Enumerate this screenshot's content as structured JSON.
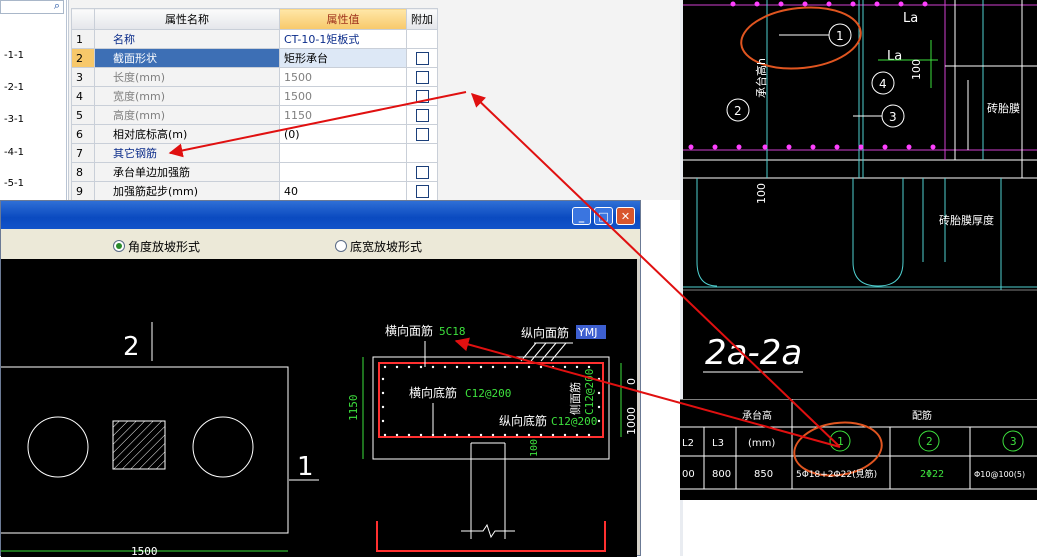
{
  "tree": {
    "items": [
      "-1-1",
      "-2-1",
      "-3-1",
      "-4-1",
      "-5-1"
    ]
  },
  "grid": {
    "headers": {
      "name": "属性名称",
      "value": "属性值",
      "extra": "附加"
    },
    "rows": [
      {
        "num": "1",
        "name": "名称",
        "value": "CT-10-1矩板式",
        "check": false,
        "style": "blue"
      },
      {
        "num": "2",
        "name": "截面形状",
        "value": "矩形承台",
        "check": true,
        "style": "sel"
      },
      {
        "num": "3",
        "name": "长度(mm)",
        "value": "1500",
        "check": true,
        "style": "gray"
      },
      {
        "num": "4",
        "name": "宽度(mm)",
        "value": "1500",
        "check": true,
        "style": "gray"
      },
      {
        "num": "5",
        "name": "高度(mm)",
        "value": "1150",
        "check": true,
        "style": "gray"
      },
      {
        "num": "6",
        "name": "相对底标高(m)",
        "value": "(0)",
        "check": true,
        "style": ""
      },
      {
        "num": "7",
        "name": "其它钢筋",
        "value": "",
        "check": false,
        "style": "blue"
      },
      {
        "num": "8",
        "name": "承台单边加强筋",
        "value": "",
        "check": true,
        "style": ""
      },
      {
        "num": "9",
        "name": "加强筋起步(mm)",
        "value": "40",
        "check": true,
        "style": ""
      }
    ]
  },
  "dialog": {
    "radio_angle": "角度放坡形式",
    "radio_width": "底宽放坡形式",
    "plan": {
      "label_2": "2",
      "label_1": "1",
      "dim": "1500"
    },
    "section": {
      "h_top_label": "横向面筋",
      "h_top_value": "5C18",
      "v_top_label": "纵向面筋",
      "v_top_value": "YMJ",
      "h_bot_label": "横向底筋",
      "h_bot_value": "C12@200",
      "v_bot_label": "纵向底筋",
      "v_bot_value": "C12@200",
      "side_label": "侧面筋",
      "side_value": "C12@200",
      "dim_height": "1150",
      "dim_0": "0",
      "dim_1000": "1000",
      "dim_100": "100"
    }
  },
  "cad": {
    "circles": [
      "1",
      "2",
      "3",
      "4"
    ],
    "la_top": "La",
    "la_mid": "La",
    "dim_100": "100",
    "dim_100b": "100",
    "cheng_tai": "承台高h",
    "zhuan_tai_mo": "砖胎膜",
    "zhuan_tai_mo_hd": "砖胎膜厚度",
    "section_title": "2a-2a",
    "table": {
      "header_left": "承台高",
      "header_right": "配筋",
      "col_a": "L2",
      "col_b": "L3",
      "col_c": "(mm)",
      "col_1": "1",
      "col_2": "2",
      "col_3": "3",
      "row_a": "00",
      "row_b": "800",
      "row_c": "850",
      "row_1": "5Φ18+2Φ22(見筋)",
      "row_2": "2Φ22",
      "row_3": "Φ10@100(5)"
    }
  },
  "colors": {
    "annotation_arrow": "#e01010",
    "rebar": "#e02020",
    "dim_green": "#3de03d"
  }
}
